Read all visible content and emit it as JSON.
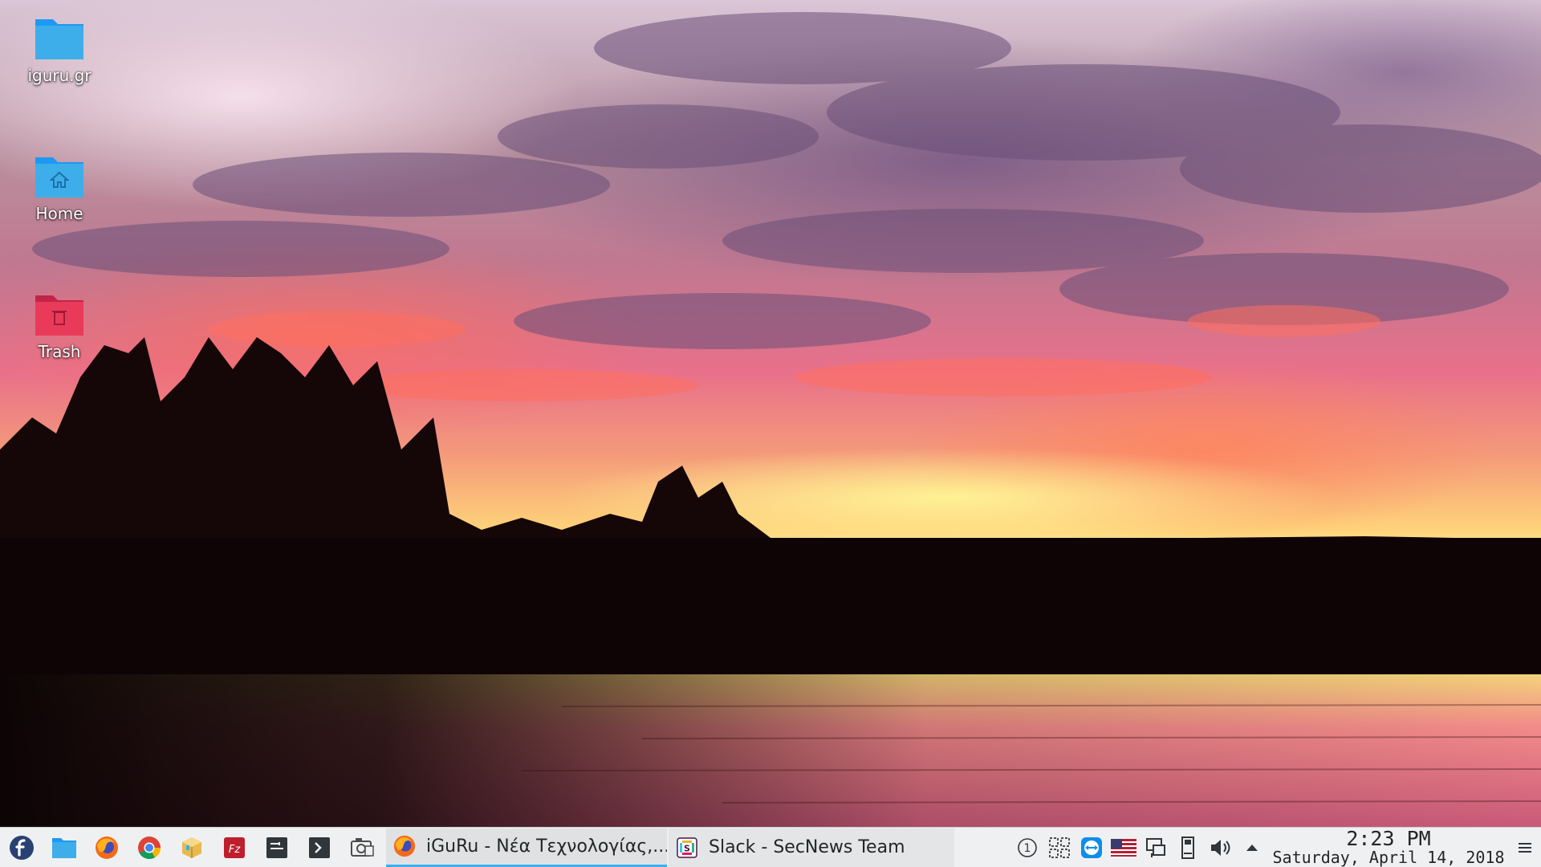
{
  "desktop": {
    "icons": [
      {
        "label": "iguru.gr",
        "icon": "folder-icon",
        "color": "#3daee9"
      },
      {
        "label": "Home",
        "icon": "home-folder-icon",
        "color": "#3daee9"
      },
      {
        "label": "Trash",
        "icon": "trash-icon",
        "color": "#e93a5a"
      }
    ]
  },
  "taskbar": {
    "launchers": [
      {
        "name": "fedora-launcher-icon"
      },
      {
        "name": "file-manager-icon"
      },
      {
        "name": "firefox-icon"
      },
      {
        "name": "chrome-icon"
      },
      {
        "name": "package-icon"
      },
      {
        "name": "filezilla-icon"
      },
      {
        "name": "terminal-icon"
      },
      {
        "name": "console-icon"
      },
      {
        "name": "screenshot-icon"
      }
    ],
    "tasks": [
      {
        "label": "iGuRu - Νέα Τεχνολογίας,...",
        "icon": "firefox-icon",
        "active": true
      },
      {
        "label": "Slack - SecNews Team",
        "icon": "slack-icon",
        "active": false
      }
    ],
    "tray": [
      {
        "name": "notification-count-icon",
        "text": "1"
      },
      {
        "name": "kde-connect-icon"
      },
      {
        "name": "teamviewer-icon"
      },
      {
        "name": "us-flag-keyboard-icon"
      },
      {
        "name": "network-icon"
      },
      {
        "name": "removable-device-icon"
      },
      {
        "name": "volume-icon"
      },
      {
        "name": "expand-tray-arrow-icon"
      }
    ],
    "clock": {
      "time": "2:23 PM",
      "date": "Saturday, April 14, 2018"
    }
  },
  "colors": {
    "accent": "#3daee9",
    "panel_bg": "#eff0f1",
    "trash": "#e93a5a"
  }
}
